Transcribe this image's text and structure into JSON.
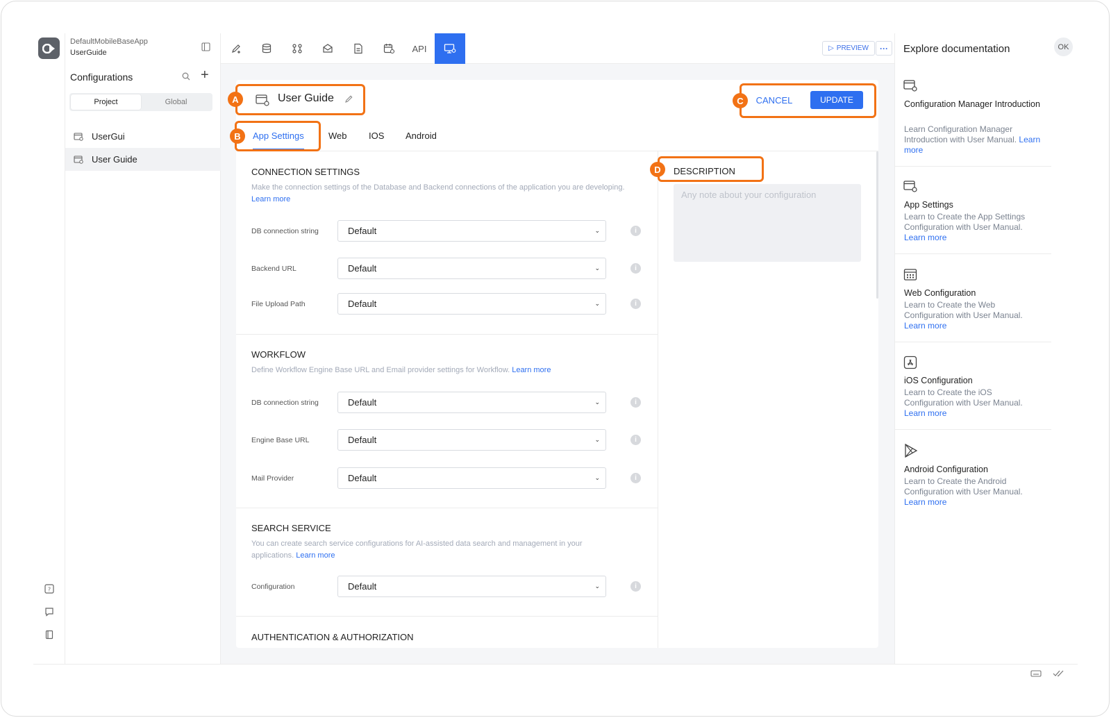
{
  "app": {
    "name": "DefaultMobileBaseApp",
    "current": "UserGuide"
  },
  "sidebar": {
    "title": "Configurations",
    "segments": [
      "Project",
      "Global"
    ],
    "items": [
      {
        "label": "UserGui"
      },
      {
        "label": "User Guide"
      }
    ]
  },
  "toolbar": {
    "api_label": "API",
    "preview_label": "PREVIEW",
    "more_label": "···"
  },
  "page": {
    "title": "User Guide",
    "cancel_label": "CANCEL",
    "update_label": "UPDATE",
    "tabs": [
      "App Settings",
      "Web",
      "IOS",
      "Android"
    ]
  },
  "sections": [
    {
      "title": "CONNECTION SETTINGS",
      "desc": "Make the connection settings of the Database and Backend connections of the application you are developing.",
      "link": "Learn more",
      "fields": [
        {
          "label": "DB connection string",
          "value": "Default"
        },
        {
          "label": "Backend URL",
          "value": "Default"
        },
        {
          "label": "File Upload Path",
          "value": "Default"
        }
      ]
    },
    {
      "title": "WORKFLOW",
      "desc": "Define Workflow Engine Base URL and Email provider settings for Workflow.",
      "link": "Learn more",
      "fields": [
        {
          "label": "DB connection string",
          "value": "Default"
        },
        {
          "label": "Engine Base URL",
          "value": "Default"
        },
        {
          "label": "Mail Provider",
          "value": "Default"
        }
      ]
    },
    {
      "title": "SEARCH SERVICE",
      "desc": "You can create search service configurations for AI-assisted data search and management in your applications.",
      "link": "Learn more",
      "fields": [
        {
          "label": "Configuration",
          "value": "Default"
        }
      ]
    },
    {
      "title": "AUTHENTICATION & AUTHORIZATION"
    }
  ],
  "description": {
    "title": "DESCRIPTION",
    "placeholder": "Any note about your configuration"
  },
  "docs": {
    "title": "Explore documentation",
    "avatar": "OK",
    "cards": [
      {
        "title": "Configuration Manager Introduction",
        "desc": "Learn Configuration Manager Introduction with User Manual.",
        "link": "Learn more"
      },
      {
        "title": "App Settings",
        "desc": "Learn to Create the App Settings Configuration with User Manual.",
        "link": "Learn more"
      },
      {
        "title": "Web Configuration",
        "desc": "Learn to Create the Web Configuration with User Manual.",
        "link": "Learn more"
      },
      {
        "title": "iOS Configuration",
        "desc": "Learn to Create the iOS Configuration with User Manual.",
        "link": "Learn more"
      },
      {
        "title": "Android Configuration",
        "desc": "Learn to Create the Android Configuration with User Manual.",
        "link": "Learn more"
      }
    ]
  },
  "annotations": [
    "A",
    "B",
    "C",
    "D"
  ],
  "colors": {
    "accent": "#2e6ff0",
    "callout": "#f27215"
  }
}
